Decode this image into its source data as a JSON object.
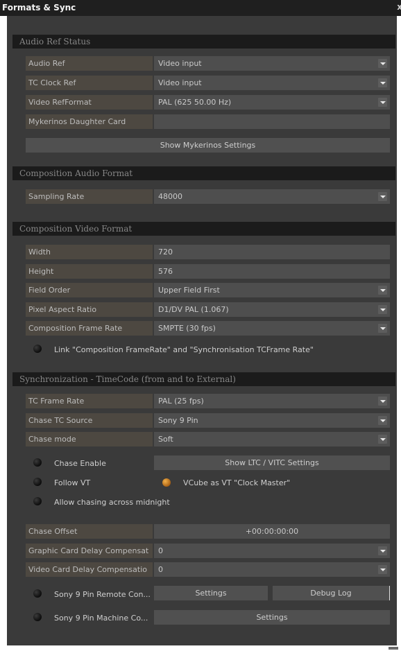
{
  "window": {
    "title": "Formats & Sync",
    "close_glyph": "x"
  },
  "audio_ref_status": {
    "header": "Audio Ref Status",
    "audio_ref": {
      "label": "Audio Ref",
      "value": "Video input"
    },
    "tc_clock_ref": {
      "label": "TC Clock Ref",
      "value": "Video input"
    },
    "video_ref_format": {
      "label": "Video RefFormat",
      "value": "PAL  (625 50.00 Hz)"
    },
    "mykerinos_card": {
      "label": "Mykerinos Daughter Card",
      "value": ""
    },
    "show_mykerinos_button": "Show Mykerinos Settings"
  },
  "composition_audio": {
    "header": "Composition Audio Format",
    "sampling_rate": {
      "label": "Sampling Rate",
      "value": "48000"
    }
  },
  "composition_video": {
    "header": "Composition Video Format",
    "width": {
      "label": "Width",
      "value": "720"
    },
    "height": {
      "label": "Height",
      "value": "576"
    },
    "field_order": {
      "label": "Field Order",
      "value": "Upper Field First"
    },
    "pixel_aspect": {
      "label": "Pixel Aspect Ratio",
      "value": "D1/DV PAL (1.067)"
    },
    "frame_rate": {
      "label": "Composition Frame Rate",
      "value": "SMPTE (30 fps)"
    },
    "link_label": "Link \"Composition FrameRate\" and \"Synchronisation TCFrame Rate\""
  },
  "synchronization": {
    "header": "Synchronization - TimeCode (from and to External)",
    "tc_frame_rate": {
      "label": "TC Frame Rate",
      "value": "PAL  (25 fps)"
    },
    "chase_tc_source": {
      "label": "Chase TC Source",
      "value": "Sony 9 Pin"
    },
    "chase_mode": {
      "label": "Chase mode",
      "value": "Soft"
    },
    "chase_enable_label": "Chase Enable",
    "show_ltc_button": "Show LTC / VITC Settings",
    "follow_vt_label": "Follow VT",
    "vcube_clock_master_label": "VCube as VT \"Clock Master\"",
    "allow_chasing_label": "Allow chasing across midnight",
    "chase_offset": {
      "label": "Chase Offset",
      "value": "+00:00:00:00"
    },
    "graphic_card_delay": {
      "label": "Graphic Card Delay Compensat",
      "value": "0"
    },
    "video_card_delay": {
      "label": "Video Card Delay Compensatio",
      "value": "0"
    },
    "sony_remote": {
      "label": "Sony 9 Pin Remote Con...",
      "settings": "Settings",
      "debug_log": "Debug Log"
    },
    "sony_machine": {
      "label": "Sony 9 Pin Machine Co...",
      "settings": "Settings"
    }
  }
}
